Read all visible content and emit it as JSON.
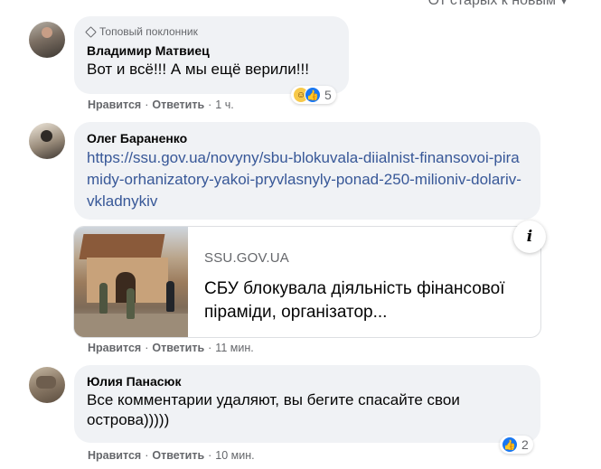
{
  "sort": {
    "label": "От старых к новым"
  },
  "comments": [
    {
      "badge": "Топовый поклонник",
      "author": "Владимир Матвиец",
      "text": "Вот и всё!!! А мы ещё верили!!!",
      "reactions": {
        "types": [
          "haha",
          "like"
        ],
        "count": "5"
      },
      "like_label": "Нравится",
      "reply_label": "Ответить",
      "time": "1 ч."
    },
    {
      "author": "Олег Бараненко",
      "link": "https://ssu.gov.ua/novyny/sbu-blokuvala-diialnist-finansovoi-piramidy-orhanizatory-yakoi-pryvlasnyly-ponad-250-milioniv-dolariv-vkladnykiv",
      "preview": {
        "domain": "SSU.GOV.UA",
        "title": "СБУ блокувала діяльність фінансової піраміди, організатор..."
      },
      "like_label": "Нравится",
      "reply_label": "Ответить",
      "time": "11 мин."
    },
    {
      "author": "Юлия Панасюк",
      "text": "Все комментарии удаляют, вы бегите спасайте свои острова)))))",
      "reactions": {
        "types": [
          "like"
        ],
        "count": "2"
      },
      "like_label": "Нравится",
      "reply_label": "Ответить",
      "time": "10 мин."
    }
  ],
  "colors": {
    "bubble": "#f0f2f5",
    "link": "#385898",
    "like": "#1877f2",
    "muted": "#65676b"
  }
}
